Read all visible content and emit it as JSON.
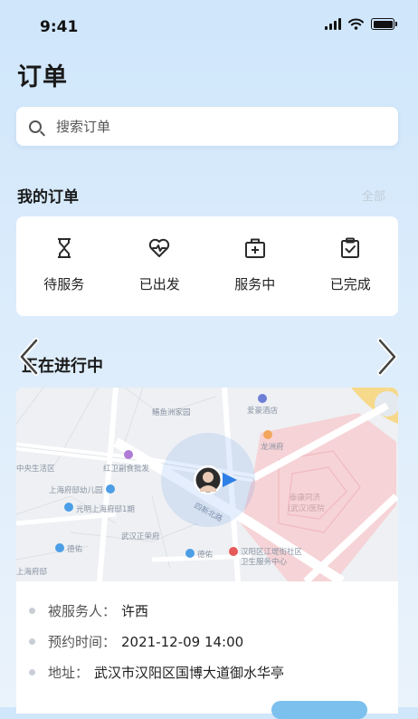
{
  "status_bar": {
    "time": "9:41"
  },
  "page": {
    "title": "订单"
  },
  "search": {
    "placeholder": "搜索订单"
  },
  "my_orders": {
    "title": "我的订单",
    "see_all": "全部",
    "statuses": [
      {
        "label": "待服务",
        "icon": "hourglass-icon"
      },
      {
        "label": "已出发",
        "icon": "heartbeat-icon"
      },
      {
        "label": "服务中",
        "icon": "medical-kit-icon"
      },
      {
        "label": "已完成",
        "icon": "clipboard-check-icon"
      }
    ]
  },
  "in_progress": {
    "title": "正在进行中",
    "map_labels": {
      "l1": "鳝鱼洲家园",
      "l2": "爱豪酒店",
      "l3": "龙洲府",
      "l4": "中央生活区",
      "l5": "红卫副食批发",
      "l6": "上海府邸幼儿园",
      "l7": "光明上海府邸1期",
      "l8": "武汉正荣府",
      "l9": "德佑",
      "l10": "德佑",
      "l11": "汉阳区江堤街社区",
      "l12": "卫生服务中心",
      "l13": "泰康同济",
      "l14": "(武汉)医院",
      "l15": "四新北路",
      "l16": "上海府邸"
    },
    "client_label": "被服务人：",
    "client_name": "许西",
    "time_label": "预约时间：",
    "time_value": "2021-12-09 14:00",
    "address_label": "地址：",
    "address_value": "武汉市汉阳区国博大道御水华亭"
  },
  "colors": {
    "accent": "#2e7fe6",
    "hospital": "#f6d3d6",
    "status_icon": "#2a2a2a"
  }
}
